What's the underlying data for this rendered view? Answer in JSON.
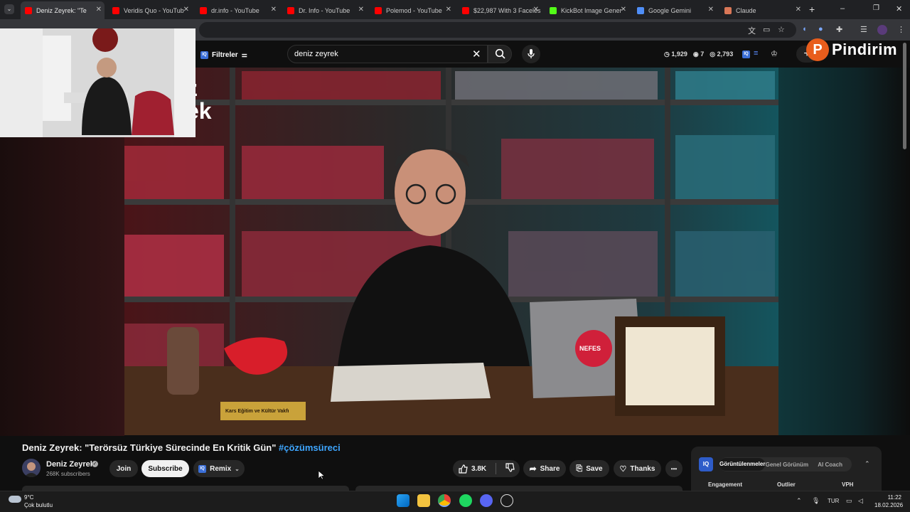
{
  "browser": {
    "tabs": [
      {
        "title": "Deniz Zeyrek: \"Te",
        "favicon_color": "#ff0000",
        "active": true
      },
      {
        "title": "Veridis Quo - YouTub",
        "favicon_color": "#ff0000"
      },
      {
        "title": "dr.info - YouTube",
        "favicon_color": "#ff0000"
      },
      {
        "title": "Dr. Info - YouTube",
        "favicon_color": "#ff0000"
      },
      {
        "title": "Polemod - YouTube",
        "favicon_color": "#ff0000"
      },
      {
        "title": "$22,987 With 3 Faceles",
        "favicon_color": "#ff0000"
      },
      {
        "title": "KickBot Image Gener",
        "favicon_color": "#53fc18"
      },
      {
        "title": "Google Gemini",
        "favicon_color": "#4f8ef7"
      },
      {
        "title": "Claude",
        "favicon_color": "#d97757"
      }
    ],
    "new_tab_label": "+",
    "window_controls": {
      "minimize": "–",
      "restore": "❐",
      "close": "✕"
    }
  },
  "youtube": {
    "filters_label": "Filtreler",
    "search_value": "deniz zeyrek",
    "stats": {
      "views": "1,929",
      "watching": "7",
      "score": "2,793"
    },
    "create_label": "+",
    "brand_name": "Pindirim",
    "brand_letter": "P"
  },
  "video": {
    "title": "Deniz Zeyrek: \"Terörsüz Türkiye Sürecinde En Kritik Gün\"",
    "hashtag": "#çözümsüreci",
    "brand_mark": "z\nek",
    "plaque_text": "Kars Eğitim ve Kültür Vakfı",
    "sticker_text": "NEFES"
  },
  "channel": {
    "name": "Deniz Zeyrek",
    "subscribers": "268K subscribers",
    "join_label": "Join",
    "subscribe_label": "Subscribe",
    "remix_label": "Remix"
  },
  "actions": {
    "likes": "3.8K",
    "share_label": "Share",
    "save_label": "Save",
    "thanks_label": "Thanks",
    "more_label": "•••"
  },
  "iq_panel": {
    "badge": "IQ",
    "tabs": [
      "Görüntülenmeler",
      "Genel Görünüm",
      "AI Coach"
    ],
    "active_tab": "Görüntülenmeler",
    "columns": [
      "Engagement",
      "Outlier",
      "VPH"
    ]
  },
  "taskbar": {
    "weather_temp": "9°C",
    "weather_desc": "Çok bulutlu",
    "language": "TUR",
    "time": "11:22",
    "date": "18.02.2026"
  }
}
